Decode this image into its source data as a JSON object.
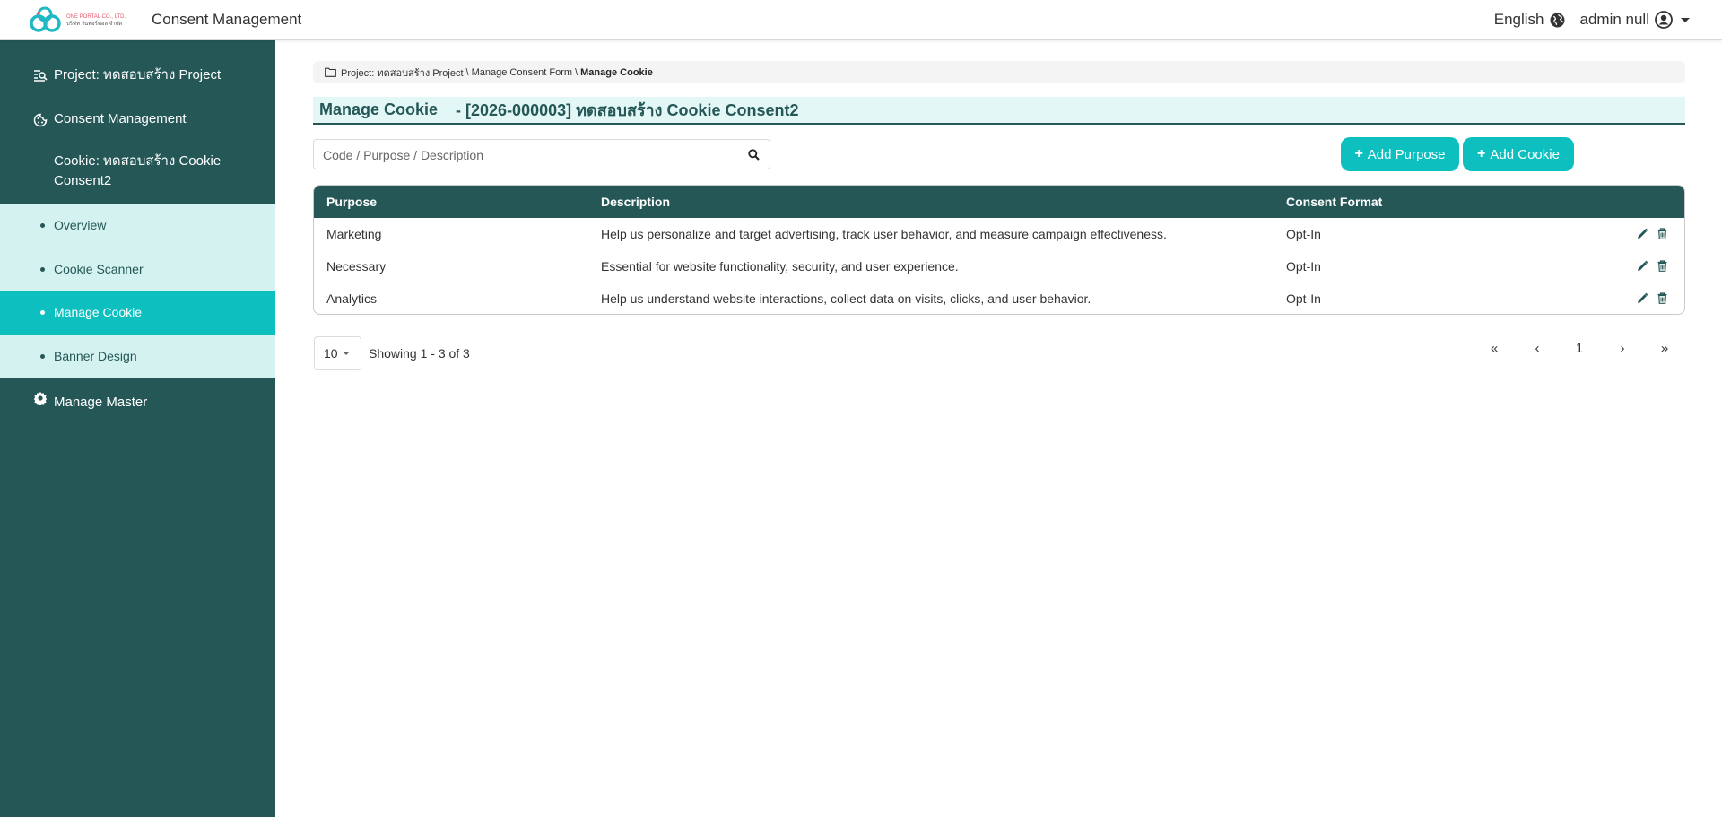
{
  "header": {
    "logo_line1": "ONE PORTAL CO., LTD.",
    "logo_line2": "บริษัท วันพอร์ทอล จำกัด",
    "app_title": "Consent Management",
    "language": "English",
    "user": "admin null"
  },
  "sidebar": {
    "items": [
      {
        "label": "Project: ทดสอบสร้าง Project",
        "icon": "project-icon"
      },
      {
        "label": "Consent Management",
        "icon": "consent-management-icon"
      },
      {
        "label_line1": "Cookie: ทดสอบสร้าง Cookie",
        "label_line2": "Consent2",
        "icon": "cookie-icon"
      },
      {
        "label": "Manage Master",
        "icon": "gear-icon"
      }
    ],
    "sub_items": [
      {
        "label": "Overview"
      },
      {
        "label": "Cookie Scanner"
      },
      {
        "label": "Manage Cookie",
        "active": true
      },
      {
        "label": "Banner Design"
      }
    ]
  },
  "breadcrumb": {
    "parts": [
      "Project: ทดสอบสร้าง Project",
      "Manage Consent Form"
    ],
    "current": "Manage Cookie",
    "separator": "\\"
  },
  "page": {
    "title": "Manage Cookie",
    "subtitle": "- [2026-000003] ทดสอบสร้าง Cookie Consent2"
  },
  "search": {
    "placeholder": "Code / Purpose / Description",
    "value": ""
  },
  "buttons": {
    "add_purpose": "Add Purpose",
    "add_cookie": "Add Cookie"
  },
  "table": {
    "columns": [
      "Purpose",
      "Description",
      "Consent Format"
    ],
    "rows": [
      {
        "purpose": "Marketing",
        "description": "Help us personalize and target advertising, track user behavior, and measure campaign effectiveness.",
        "format": "Opt-In"
      },
      {
        "purpose": "Necessary",
        "description": "Essential for website functionality, security, and user experience.",
        "format": "Opt-In"
      },
      {
        "purpose": "Analytics",
        "description": "Help us understand website interactions, collect data on visits, clicks, and user behavior.",
        "format": "Opt-In"
      }
    ]
  },
  "pagination": {
    "page_size": "10",
    "showing": "Showing 1 - 3 of 3",
    "first": "«",
    "prev": "‹",
    "current_page": "1",
    "next": "›",
    "last": "»"
  },
  "colors": {
    "sidebar_bg": "#255757",
    "accent": "#0dbfbf",
    "submenu_bg": "#d3f2f0",
    "header_band": "#e3f8f6"
  }
}
